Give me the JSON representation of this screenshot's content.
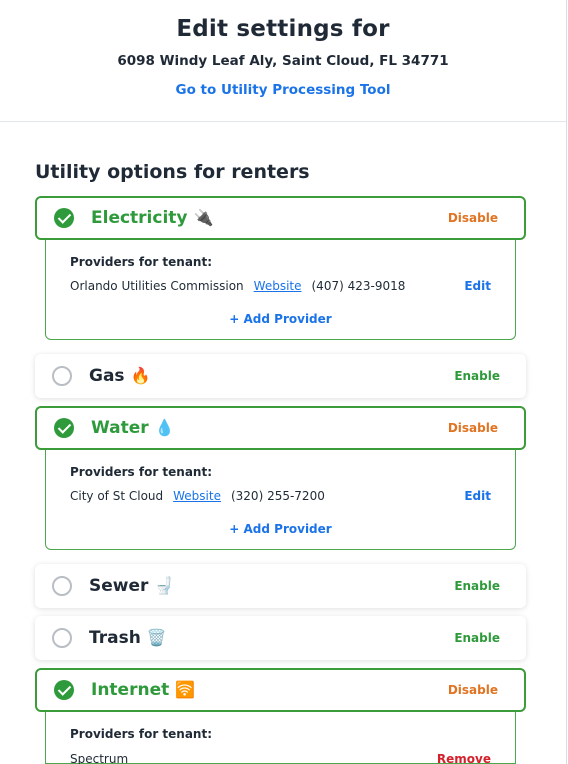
{
  "header": {
    "title": "Edit settings for",
    "address": "6098 Windy Leaf Aly, Saint Cloud, FL 34771",
    "tool_link": "Go to Utility Processing Tool"
  },
  "section_title": "Utility options for renters",
  "utilities": {
    "electricity": {
      "name": "Electricity",
      "emoji": "🔌",
      "enabled": true,
      "action": "Disable"
    },
    "gas": {
      "name": "Gas",
      "emoji": "🔥",
      "enabled": false,
      "action": "Enable"
    },
    "water": {
      "name": "Water",
      "emoji": "💧",
      "enabled": true,
      "action": "Disable"
    },
    "sewer": {
      "name": "Sewer",
      "emoji": "🚽",
      "enabled": false,
      "action": "Enable"
    },
    "trash": {
      "name": "Trash",
      "emoji": "🗑️",
      "enabled": false,
      "action": "Enable"
    },
    "internet": {
      "name": "Internet",
      "emoji": "🛜",
      "enabled": true,
      "action": "Disable"
    }
  },
  "providers": {
    "title": "Providers for tenant:",
    "add_label": "+ Add Provider",
    "website_label": "Website",
    "edit_label": "Edit",
    "remove_label": "Remove",
    "electricity": {
      "name": "Orlando Utilities Commission",
      "phone": "(407) 423-9018"
    },
    "water": {
      "name": "City of St Cloud",
      "phone": "(320) 255-7200"
    },
    "internet": {
      "name": "Spectrum"
    }
  },
  "colors": {
    "enabled_green": "#2f9a3b",
    "disable_orange": "#e07422",
    "link_blue": "#1a73e8",
    "remove_red": "#d3202a",
    "text_dark": "#1f2a36"
  }
}
